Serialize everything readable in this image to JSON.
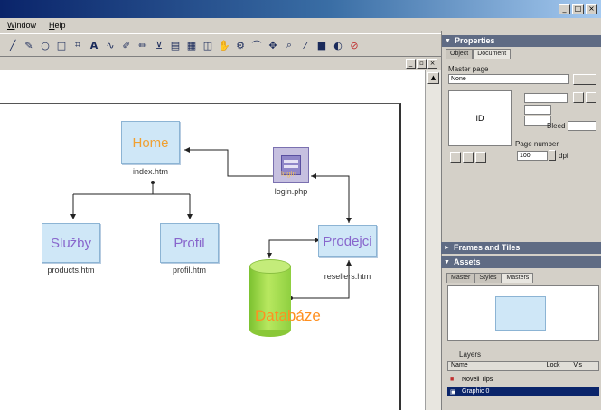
{
  "menubar": {
    "items": [
      "Window",
      "Help"
    ]
  },
  "toolbar": {
    "tools": [
      "line-icon",
      "pen-icon",
      "ellipse-icon",
      "rectangle-icon",
      "crop-icon",
      "text-icon",
      "bezier-icon",
      "brush-icon",
      "pencil-icon",
      "bucket-icon",
      "chart-icon",
      "table-icon",
      "layer-icon",
      "hand-icon",
      "gear-icon",
      "arc-icon",
      "move-icon",
      "zoom-icon",
      "eyedropper-icon",
      "color-icon",
      "eraser-icon",
      "slice-icon"
    ]
  },
  "diagram": {
    "nodes": [
      {
        "label": "Home",
        "caption": "index.htm"
      },
      {
        "label": "Služby",
        "caption": "products.htm"
      },
      {
        "label": "Profil",
        "caption": "profil.htm"
      },
      {
        "label": "Prodejci",
        "caption": "resellers.htm"
      },
      {
        "label": "login",
        "caption": "login.php"
      }
    ],
    "database_label": "Databáze"
  },
  "panel": {
    "properties_title": "Properties",
    "tabs": [
      "Object",
      "Document"
    ],
    "master_page_label": "Master page",
    "master_page_value": "None",
    "preview_text": "ID",
    "bleed_label": "Bleed",
    "page_number_label": "Page number",
    "page_number_value": "100",
    "unit": "dpi",
    "frames_title": "Frames and Tiles",
    "assets_title": "Assets",
    "asset_tabs": [
      "Master",
      "Styles",
      "Masters"
    ],
    "layers_title": "Layers",
    "layers_columns": [
      "Name",
      "Lock",
      "Vis"
    ],
    "layers": [
      {
        "name": "Novell Tips",
        "selected": false
      },
      {
        "name": "Graphic 0",
        "selected": true
      }
    ]
  },
  "colors": {
    "node_fill": "#cfe7f7",
    "home_text": "#f0a030",
    "nav_text": "#8866cc",
    "db_green": "#9ed848",
    "db_text": "#ff9020"
  }
}
